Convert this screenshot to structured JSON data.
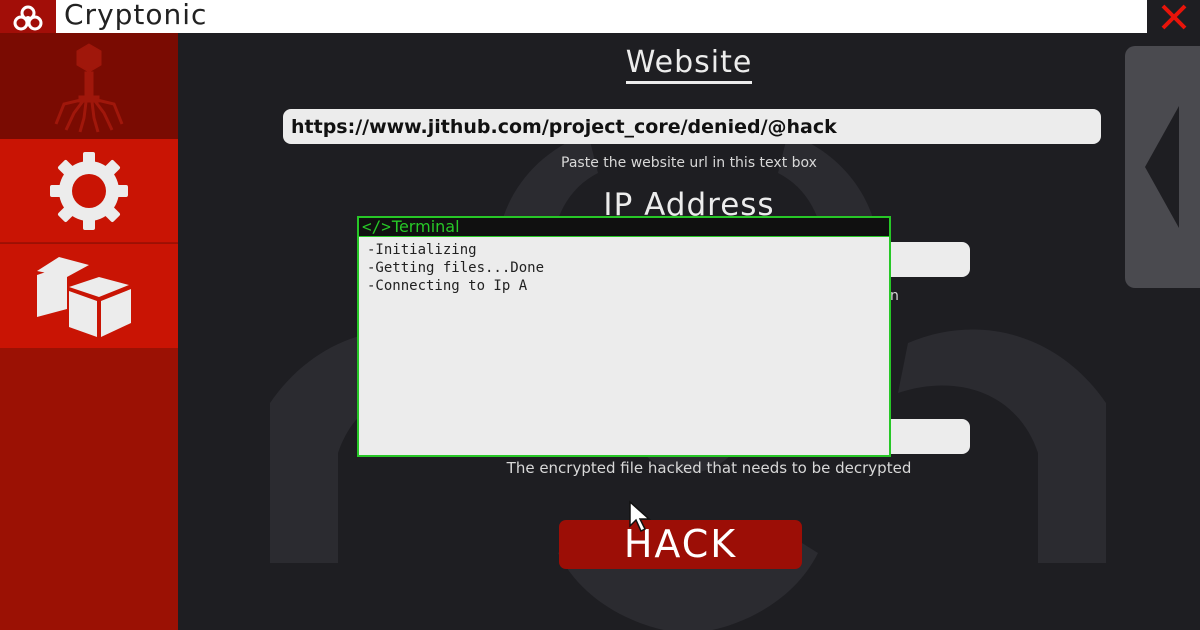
{
  "app": {
    "title": "Cryptonic"
  },
  "sidebar": {
    "items": [
      {
        "icon": "virus-icon",
        "selected": true
      },
      {
        "icon": "gear-icon",
        "selected": false
      },
      {
        "icon": "boxes-icon",
        "selected": false
      }
    ]
  },
  "form": {
    "website_heading": "Website",
    "url_value": "https://www.jithub.com/project_core/denied/@hack",
    "url_hint": "Paste the website url in this text box",
    "ip_heading": "IP Address",
    "ip_hint_tail": "n",
    "file_hint": "The encrypted file hacked that needs to be decrypted",
    "hack_label": "HACK"
  },
  "terminal": {
    "icon": "</>",
    "title": "Terminal",
    "lines": [
      "-Initializing",
      "-Getting files...Done",
      "-Connecting to Ip A"
    ]
  },
  "colors": {
    "accent": "#c91404",
    "accent_dark": "#9b1104",
    "terminal_green": "#27c727",
    "background": "#1e1e22"
  }
}
